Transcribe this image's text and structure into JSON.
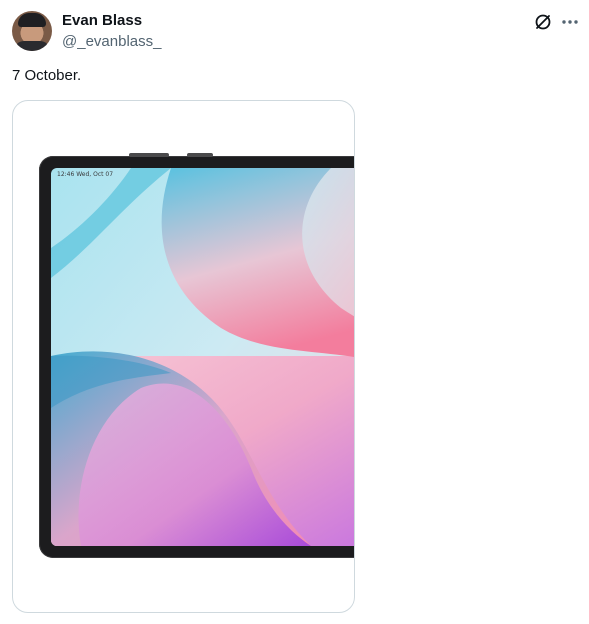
{
  "author": {
    "display_name": "Evan Blass",
    "handle": "@_evanblass_"
  },
  "tweet": {
    "text": "7 October."
  },
  "media": {
    "status_bar_text": "12:46 Wed, Oct 07"
  },
  "icons": {
    "grok": "grok-icon",
    "more": "more-options-icon"
  },
  "colors": {
    "text_primary": "#0f1419",
    "text_secondary": "#536471",
    "border": "#cfd9de"
  }
}
